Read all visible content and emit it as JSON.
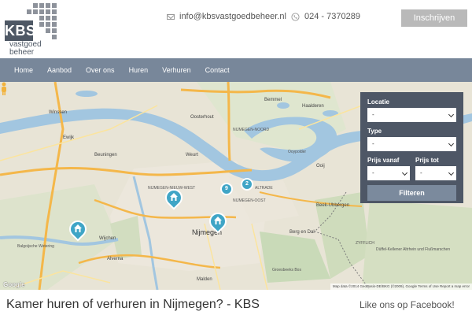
{
  "logo": {
    "abbr": "KBS",
    "line1": "vastgoed",
    "line2": "beheer"
  },
  "contact": {
    "email": "info@kbsvastgoedbeheer.nl",
    "phone": "024 - 7370289",
    "email_icon": "envelope-icon",
    "phone_icon": "phone-icon"
  },
  "header": {
    "signup_label": "Inschrijven"
  },
  "nav": {
    "items": [
      "Home",
      "Aanbod",
      "Over ons",
      "Huren",
      "Verhuren",
      "Contact"
    ]
  },
  "map": {
    "city_label": "Nijmegen",
    "labels": {
      "winssen": "Winssen",
      "ewijk": "Ewijk",
      "beuningen": "Beuningen",
      "weurt": "Weurt",
      "oosterhout": "Oosterhout",
      "bemmel": "Bemmel",
      "haalderen": "Haalderen",
      "ooij": "Ooij",
      "nijmegen_oost": "NIJMEGEN-OOST",
      "beek": "Beek-Ubbergen",
      "berg_en_dal": "Berg en Dal",
      "wijchen": "Wijchen",
      "alverna": "Alverna",
      "malden": "Malden",
      "groesbeek": "Groesbeeks Bos",
      "nijmegen_noord": "NIJMEGEN-NOORD",
      "zyfflich": "ZYFFLICH",
      "altrade": "ALTRADE",
      "balgoijen": "Balgoijsche Wetering",
      "duffel": "Düffel-Kellener Altrhein und Flußmarschen",
      "nijmegen_nw": "NIJMEGEN-NIEUW-WEST",
      "ooypolder": "Ooypolder"
    },
    "cluster_counts": [
      "9",
      "2"
    ],
    "attribution": "Map data ©2014 GeoBasis-DE/BKG (©2009), Google  Terms of Use  Report a map error",
    "google": "Google",
    "road_color": "#f4b74a",
    "water_color": "#a2c6e0",
    "pin_color": "#3fa5c6"
  },
  "filter": {
    "locatie_label": "Locatie",
    "locatie_value": "-",
    "type_label": "Type",
    "type_value": "-",
    "prijs_vanaf_label": "Prijs vanaf",
    "prijs_vanaf_value": "-",
    "prijs_tot_label": "Prijs tot",
    "prijs_tot_value": "-",
    "submit_label": "Filteren"
  },
  "page": {
    "title": "Kamer huren of verhuren in Nijmegen? - KBS",
    "facebook": "Like ons op Facebook!"
  }
}
